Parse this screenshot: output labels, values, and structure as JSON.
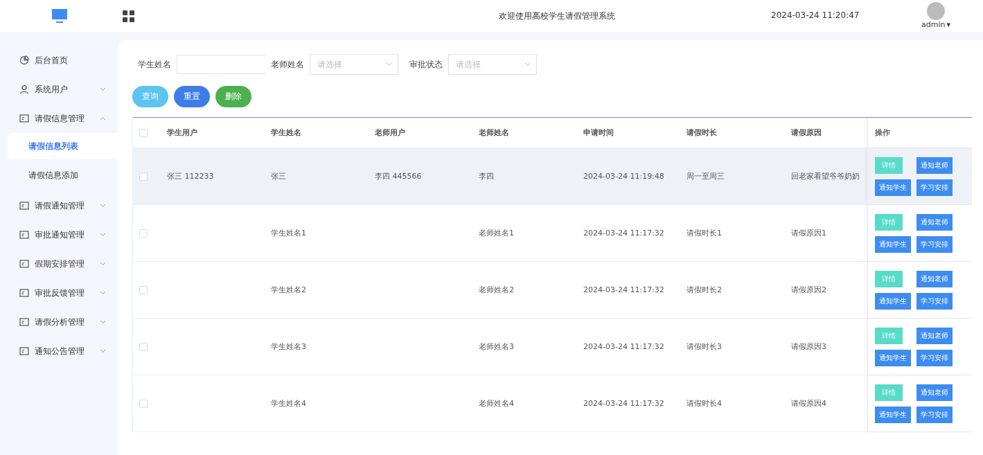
{
  "header": {
    "title": "欢迎使用高校学生请假管理系统",
    "datetime": "2024-03-24 11:20:47",
    "user": "admin",
    "caret": "▾"
  },
  "sidebar": {
    "items": [
      {
        "label": "后台首页"
      },
      {
        "label": "系统用户",
        "expanded": false
      },
      {
        "label": "请假信息管理",
        "expanded": true,
        "children": [
          {
            "label": "请假信息列表",
            "selected": true
          },
          {
            "label": "请假信息添加",
            "selected": false
          }
        ]
      },
      {
        "label": "请假通知管理",
        "expanded": false
      },
      {
        "label": "审批通知管理",
        "expanded": false
      },
      {
        "label": "假期安排管理",
        "expanded": false
      },
      {
        "label": "审批反馈管理",
        "expanded": false
      },
      {
        "label": "请假分析管理",
        "expanded": false
      },
      {
        "label": "通知公告管理",
        "expanded": false
      }
    ]
  },
  "filters": [
    {
      "kind": "input",
      "label": "学生姓名"
    },
    {
      "kind": "select",
      "label": "老师姓名",
      "placeholder": "请选择"
    },
    {
      "kind": "select",
      "label": "审批状态",
      "placeholder": "请选择"
    }
  ],
  "buttons": [
    {
      "label": "查询",
      "kind": "query"
    },
    {
      "label": "重置",
      "kind": "reset"
    },
    {
      "label": "删除",
      "kind": "delete"
    }
  ],
  "table": {
    "select_all_checked": false,
    "columns": [
      "学生用户",
      "学生姓名",
      "老师用户",
      "老师姓名",
      "申请时间",
      "请假时长",
      "请假原因",
      "操作"
    ],
    "rows": [
      {
        "highlighted": true,
        "checked": false,
        "cells": [
          "张三 112233",
          "张三",
          "李四 445566",
          "李四",
          "2024-03-24 11:19:48",
          "周一至周三",
          "回老家看望爷爷奶奶"
        ],
        "actions": [
          {
            "label": "详情",
            "kind": "detail"
          },
          {
            "label": "通知老师",
            "kind": "primary"
          },
          {
            "label": "通知学生",
            "kind": "primary"
          },
          {
            "label": "学习安排",
            "kind": "primary"
          }
        ]
      },
      {
        "highlighted": false,
        "checked": false,
        "cells": [
          "",
          "学生姓名1",
          "",
          "老师姓名1",
          "2024-03-24 11:17:32",
          "请假时长1",
          "请假原因1"
        ],
        "actions": [
          {
            "label": "详情",
            "kind": "detail"
          },
          {
            "label": "通知老师",
            "kind": "primary"
          },
          {
            "label": "通知学生",
            "kind": "primary"
          },
          {
            "label": "学习安排",
            "kind": "primary"
          }
        ]
      },
      {
        "highlighted": false,
        "checked": false,
        "cells": [
          "",
          "学生姓名2",
          "",
          "老师姓名2",
          "2024-03-24 11:17:32",
          "请假时长2",
          "请假原因2"
        ],
        "actions": [
          {
            "label": "详情",
            "kind": "detail"
          },
          {
            "label": "通知老师",
            "kind": "primary"
          },
          {
            "label": "通知学生",
            "kind": "primary"
          },
          {
            "label": "学习安排",
            "kind": "primary"
          }
        ]
      },
      {
        "highlighted": false,
        "checked": false,
        "cells": [
          "",
          "学生姓名3",
          "",
          "老师姓名3",
          "2024-03-24 11:17:32",
          "请假时长3",
          "请假原因3"
        ],
        "actions": [
          {
            "label": "详情",
            "kind": "detail"
          },
          {
            "label": "通知老师",
            "kind": "primary"
          },
          {
            "label": "通知学生",
            "kind": "primary"
          },
          {
            "label": "学习安排",
            "kind": "primary"
          }
        ]
      },
      {
        "highlighted": false,
        "checked": false,
        "cells": [
          "",
          "学生姓名4",
          "",
          "老师姓名4",
          "2024-03-24 11:17:32",
          "请假时长4",
          "请假原因4"
        ],
        "actions": [
          {
            "label": "详情",
            "kind": "detail"
          },
          {
            "label": "通知老师",
            "kind": "primary"
          },
          {
            "label": "通知学生",
            "kind": "primary"
          },
          {
            "label": "学习安排",
            "kind": "primary"
          }
        ]
      }
    ]
  }
}
